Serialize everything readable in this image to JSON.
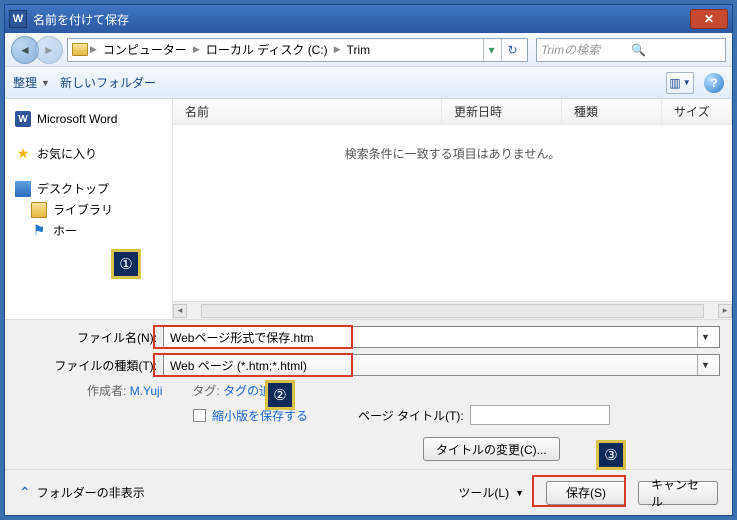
{
  "titlebar": {
    "app_letter": "W",
    "title": "名前を付けて保存"
  },
  "path": {
    "segments": [
      "コンピューター",
      "ローカル ディスク (C:)",
      "Trim"
    ]
  },
  "search": {
    "placeholder": "Trimの検索"
  },
  "toolbar": {
    "organize": "整理",
    "newfolder": "新しいフォルダー"
  },
  "sidebar": {
    "word": "Microsoft Word",
    "fav": "お気に入り",
    "desktop": "デスクトップ",
    "libs": "ライブラリ",
    "homegroup": "ホー"
  },
  "columns": {
    "name": "名前",
    "date": "更新日時",
    "type": "種類",
    "size": "サイズ"
  },
  "empty_msg": "検索条件に一致する項目はありません。",
  "form": {
    "filename_label": "ファイル名(N):",
    "filename_value": "Webページ形式で保存.htm",
    "filetype_label": "ファイルの種類(T):",
    "filetype_value": "Web ページ (*.htm;*.html)",
    "author_label": "作成者:",
    "author_value": "M.Yuji",
    "tag_label": "タグ:",
    "tag_value": "タグの追加",
    "thumb_label": "縮小版を保存する",
    "page_title_label": "ページ タイトル(T):",
    "change_title_btn": "タイトルの変更(C)..."
  },
  "footer": {
    "hide": "フォルダーの非表示",
    "tools": "ツール(L)",
    "save": "保存(S)",
    "cancel": "キャンセル"
  },
  "annot": {
    "a1": "①",
    "a2": "②",
    "a3": "③"
  }
}
